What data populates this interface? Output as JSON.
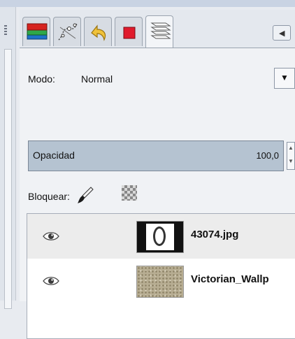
{
  "tabs": [
    {
      "name": "layers-icon",
      "active": false
    },
    {
      "name": "paths-icon",
      "active": false
    },
    {
      "name": "undo-history-icon",
      "active": false
    },
    {
      "name": "channels-icon",
      "active": false
    },
    {
      "name": "layers-stack-icon",
      "active": true
    }
  ],
  "mode": {
    "label": "Modo:",
    "value": "Normal"
  },
  "opacity": {
    "label": "Opacidad",
    "value": "100,0"
  },
  "lock": {
    "label": "Bloquear:"
  },
  "layers": [
    {
      "name": "43074.jpg",
      "visible": true
    },
    {
      "name": "Victorian_Wallp",
      "visible": true
    }
  ]
}
